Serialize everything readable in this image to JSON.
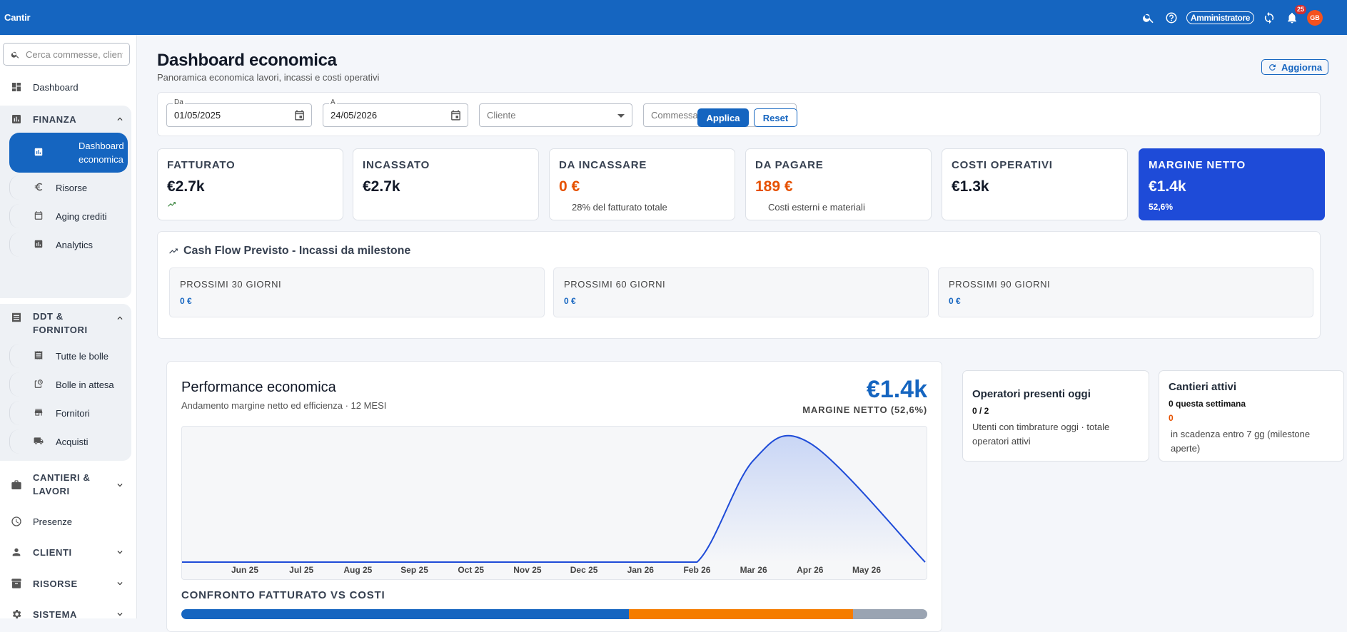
{
  "app": {
    "title": "Cantir"
  },
  "topbar": {
    "role": "Amministratore",
    "notif_count": "25",
    "avatar": "GB"
  },
  "sidebar": {
    "search_placeholder": "Cerca commesse, clienti...",
    "dashboard": "Dashboard",
    "finanza": {
      "label": "FINANZA",
      "items": [
        "Dashboard economica",
        "Risorse",
        "Aging crediti",
        "Analytics"
      ]
    },
    "ddt": {
      "label": "DDT & FORNITORI",
      "items": [
        "Tutte le bolle",
        "Bolle in attesa",
        "Fornitori",
        "Acquisti"
      ]
    },
    "cantieri": "CANTIERI & LAVORI",
    "presenze": "Presenze",
    "clienti": "CLIENTI",
    "risorse": "RISORSE",
    "sistema": "SISTEMA"
  },
  "page": {
    "title": "Dashboard economica",
    "subtitle": "Panoramica economica lavori, incassi e costi operativi",
    "refresh": "Aggiorna"
  },
  "filters": {
    "da_label": "Da",
    "da_value": "01/05/2025",
    "a_label": "A",
    "a_value": "24/05/2026",
    "cliente": "Cliente",
    "commessa": "Commessa",
    "apply": "Applica",
    "reset": "Reset"
  },
  "kpis": [
    {
      "title": "FATTURATO",
      "value": "€2.7k",
      "sub": ""
    },
    {
      "title": "INCASSATO",
      "value": "€2.7k",
      "sub": ""
    },
    {
      "title": "DA INCASSARE",
      "value": "0 €",
      "sub": "28% del fatturato totale"
    },
    {
      "title": "DA PAGARE",
      "value": "189 €",
      "sub": "Costi esterni e materiali"
    },
    {
      "title": "COSTI OPERATIVI",
      "value": "€1.3k",
      "sub": ""
    },
    {
      "title": "MARGINE NETTO",
      "value": "€1.4k",
      "sub": "52,6%"
    }
  ],
  "cashflow": {
    "title": "Cash Flow Previsto - Incassi da milestone",
    "boxes": [
      {
        "label": "PROSSIMI 30 GIORNI",
        "value": "0 €"
      },
      {
        "label": "PROSSIMI 60 GIORNI",
        "value": "0 €"
      },
      {
        "label": "PROSSIMI 90 GIORNI",
        "value": "0 €"
      }
    ]
  },
  "performance": {
    "title": "Performance economica",
    "subtitle": "Andamento margine netto ed efficienza · 12 MESI",
    "big_value": "€1.4k",
    "big_label": "MARGINE NETTO (52,6%)",
    "compare_title": "CONFRONTO FATTURATO VS COSTI"
  },
  "chart_data": {
    "type": "area",
    "x": [
      "Jun 25",
      "Jul 25",
      "Aug 25",
      "Sep 25",
      "Oct 25",
      "Nov 25",
      "Dec 25",
      "Jan 26",
      "Feb 26",
      "Mar 26",
      "Apr 26",
      "May 26"
    ],
    "values": [
      0,
      0,
      0,
      0,
      0,
      0,
      0,
      0,
      0,
      1200,
      1400,
      0
    ],
    "title": "",
    "xlabel": "",
    "ylabel": "",
    "grid": false,
    "colors": {
      "line": "#1e4bd8",
      "fill": "#c9d6f5"
    }
  },
  "compare_bar": {
    "fatturato": 0.6,
    "costi": 0.3,
    "resto": 0.1,
    "colors": [
      "#1565c0",
      "#f57c00",
      "#9aa4b2"
    ]
  },
  "side_cards": [
    {
      "title": "Operatori presenti oggi",
      "value": "0 / 2",
      "desc": "Utenti con timbrature oggi · totale operatori attivi"
    },
    {
      "title": "Cantieri attivi",
      "value": "0 questa settimana",
      "value2": "0",
      "desc": "in scadenza entro 7 gg (milestone aperte)"
    }
  ]
}
